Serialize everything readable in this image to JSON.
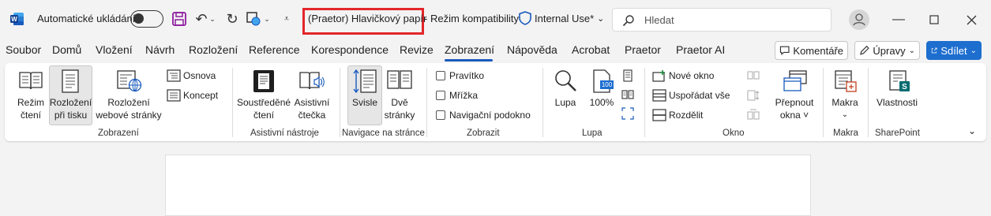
{
  "titlebar": {
    "autosave_label": "Automatické ukládání",
    "document_title": "(Praetor) Hlavičkový papír",
    "separator": "-",
    "compat_mode": "Režim kompatibility",
    "sensitivity_label": "Internal Use*",
    "search_placeholder": "Hledat",
    "accent_color": "#185abd",
    "highlight_color": "#e3262a"
  },
  "menu": {
    "tabs": [
      "Soubor",
      "Domů",
      "Vložení",
      "Návrh",
      "Rozložení",
      "Reference",
      "Korespondence",
      "Revize",
      "Zobrazení",
      "Nápověda",
      "Acrobat",
      "Praetor",
      "Praetor AI"
    ],
    "active_tab": "Zobrazení",
    "comments_label": "Komentáře",
    "editing_label": "Úpravy",
    "share_label": "Sdílet"
  },
  "ribbon": {
    "views": {
      "read_mode": [
        "Režim",
        "čtení"
      ],
      "print_layout": [
        "Rozložení",
        "při tisku"
      ],
      "web_layout": [
        "Rozložení",
        "webové stránky"
      ],
      "outline": "Osnova",
      "draft": "Koncept",
      "group_label": "Zobrazení"
    },
    "immersive": {
      "focus": [
        "Soustředěné",
        "čtení"
      ],
      "reader": [
        "Asistivní",
        "čtečka"
      ],
      "group_label": "Asistivní nástroje"
    },
    "page_movement": {
      "vertical": "Svisle",
      "side_by_side": [
        "Dvě",
        "stránky"
      ],
      "group_label": "Navigace na stránce"
    },
    "show": {
      "ruler": "Pravítko",
      "gridlines": "Mřížka",
      "nav_pane": "Navigační podokno",
      "group_label": "Zobrazit"
    },
    "zoom": {
      "zoom": "Lupa",
      "hundred": "100%",
      "badge": "100",
      "group_label": "Lupa"
    },
    "window": {
      "new_window": "Nové okno",
      "arrange_all": "Uspořádat vše",
      "split": "Rozdělit",
      "switch": [
        "Přepnout",
        "okna ˅"
      ],
      "group_label": "Okno"
    },
    "macros": {
      "macros": "Makra",
      "group_label": "Makra"
    },
    "sharepoint": {
      "properties": "Vlastnosti",
      "group_label": "SharePoint"
    }
  }
}
